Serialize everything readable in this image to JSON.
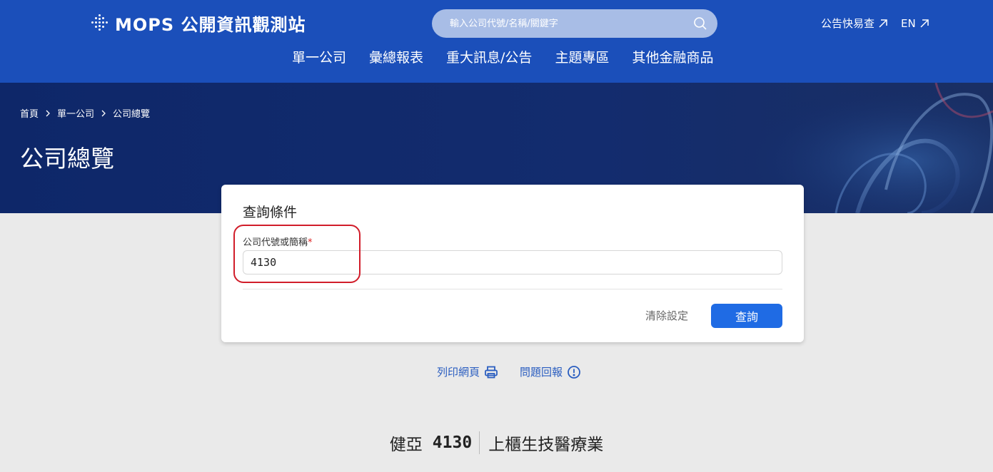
{
  "header": {
    "logo_text": "MOPS 公開資訊觀測站",
    "search_placeholder": "輸入公司代號/名稱/關鍵字",
    "links": [
      {
        "label": "公告快易查"
      },
      {
        "label": "EN"
      }
    ],
    "nav": [
      "單一公司",
      "彙總報表",
      "重大訊息/公告",
      "主題專區",
      "其他金融商品"
    ]
  },
  "banner": {
    "breadcrumb": [
      "首頁",
      "單一公司",
      "公司總覽"
    ],
    "title": "公司總覽"
  },
  "query": {
    "title": "查詢條件",
    "field_label": "公司代號或簡稱",
    "required_mark": "*",
    "field_value": "4130",
    "clear_label": "清除設定",
    "submit_label": "查詢"
  },
  "tools": {
    "print_label": "列印網頁",
    "report_label": "問題回報"
  },
  "result": {
    "name": "健亞",
    "code": "4130",
    "category": "上櫃生技醫療業"
  },
  "colors": {
    "header_bg": "#1b4fba",
    "banner_bg": "#0e2769",
    "primary_button": "#1f6be4",
    "highlight_border": "#d11d2a",
    "link": "#2b5ec0"
  }
}
